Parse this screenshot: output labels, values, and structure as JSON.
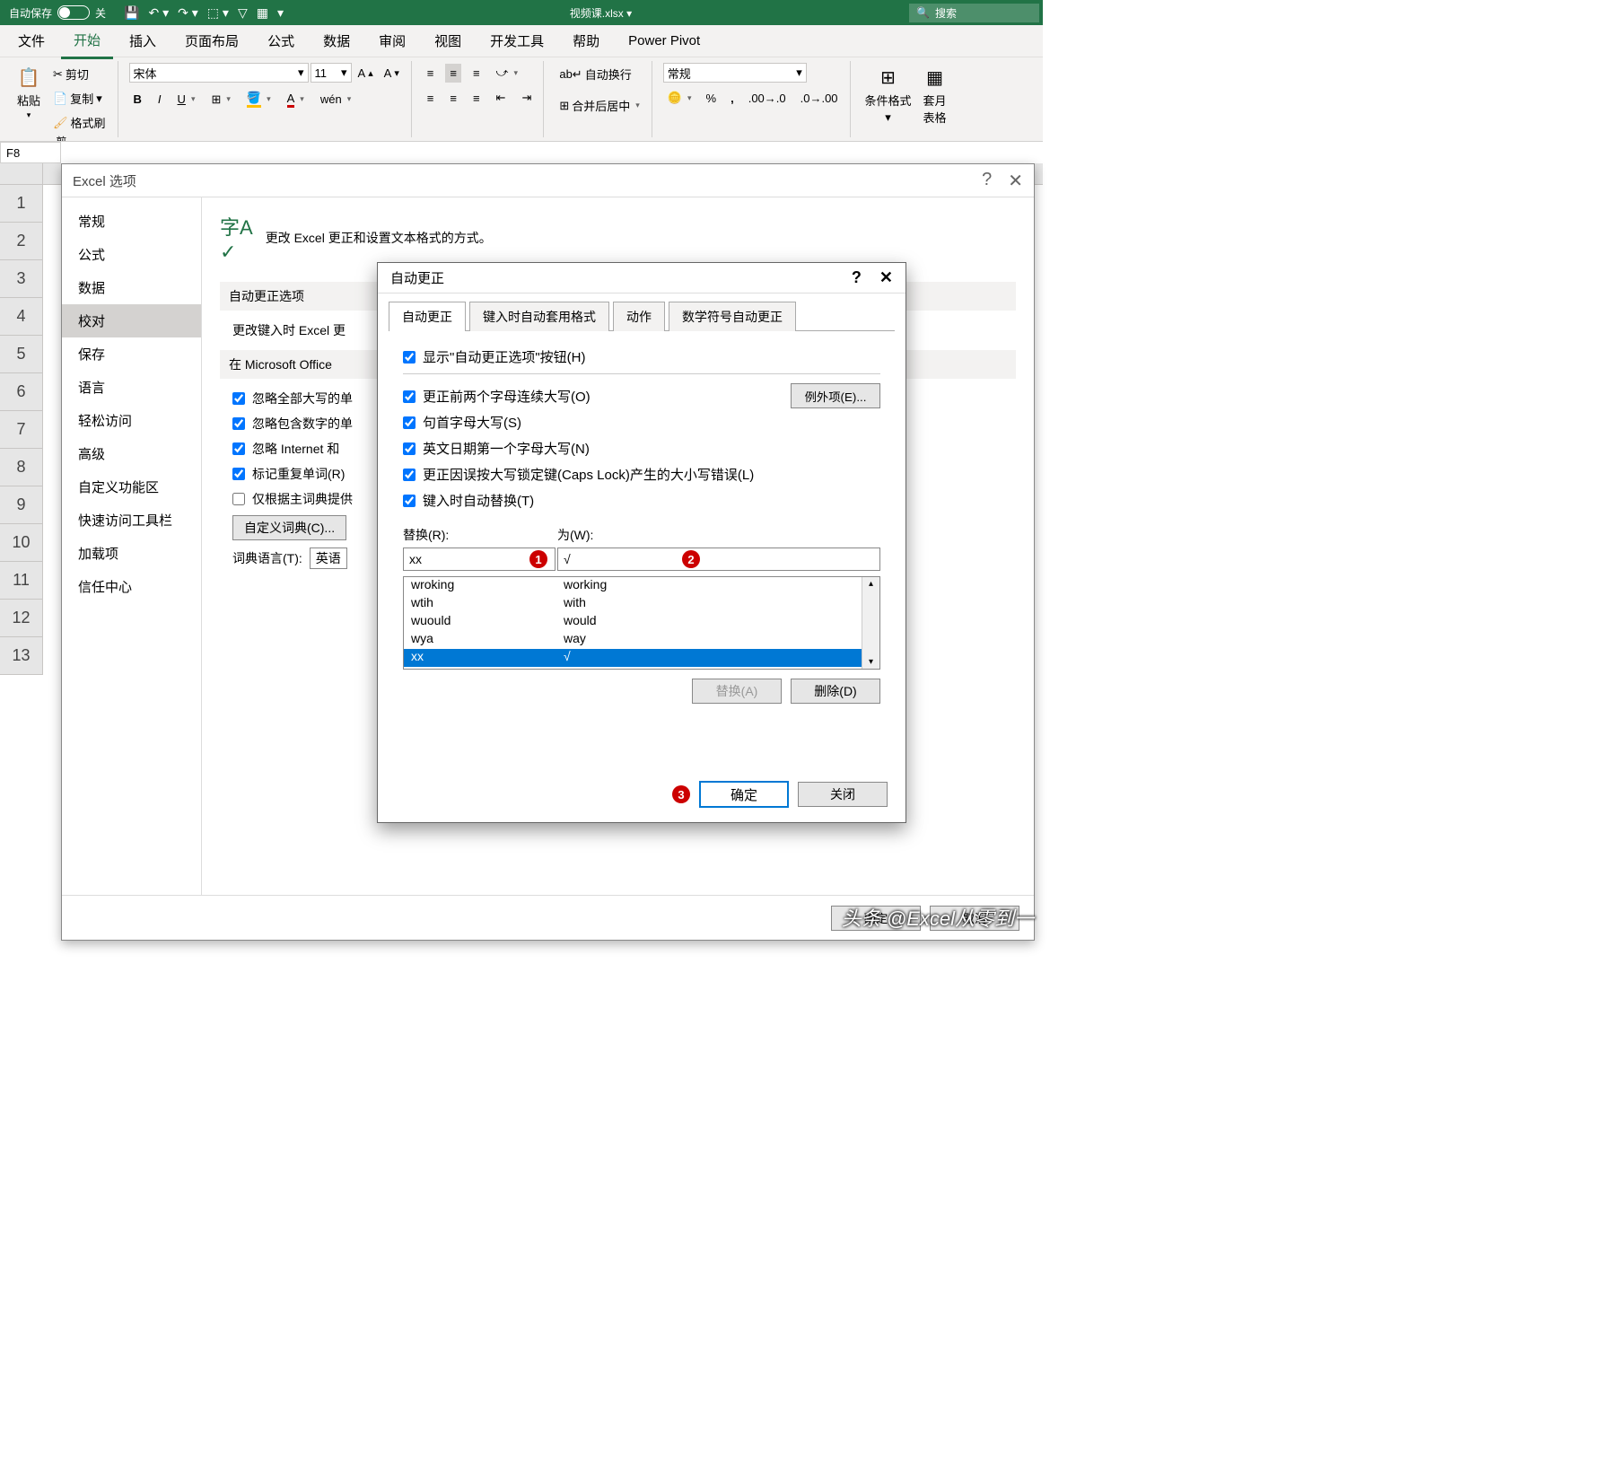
{
  "titlebar": {
    "autosave": "自动保存",
    "autosave_state": "关",
    "doc_title": "视频课.xlsx",
    "search_placeholder": "搜索"
  },
  "ribbon_tabs": [
    "文件",
    "开始",
    "插入",
    "页面布局",
    "公式",
    "数据",
    "审阅",
    "视图",
    "开发工具",
    "帮助",
    "Power Pivot"
  ],
  "ribbon_active_tab": 1,
  "ribbon": {
    "clipboard": {
      "paste": "粘贴",
      "cut": "剪切",
      "copy": "复制",
      "format_painter": "格式刷",
      "group": "剪"
    },
    "font": {
      "name": "宋体",
      "size": "11",
      "wen": "wén"
    },
    "alignment": {
      "wrap": "自动换行",
      "merge": "合并后居中"
    },
    "number": {
      "format": "常规"
    },
    "styles": {
      "conditional": "条件格式",
      "table": "套月\n表格"
    }
  },
  "name_box": "F8",
  "row_numbers": [
    1,
    2,
    3,
    4,
    5,
    6,
    7,
    8,
    9,
    10,
    11,
    12,
    13
  ],
  "options_dialog": {
    "title": "Excel 选项",
    "nav": [
      "常规",
      "公式",
      "数据",
      "校对",
      "保存",
      "语言",
      "轻松访问",
      "高级",
      "自定义功能区",
      "快速访问工具栏",
      "加载项",
      "信任中心"
    ],
    "nav_selected": 3,
    "header_text": "更改 Excel 更正和设置文本格式的方式。",
    "section1": "自动更正选项",
    "section1_label": "更改键入时 Excel 更",
    "section2": "在 Microsoft Office",
    "checks": [
      "忽略全部大写的单",
      "忽略包含数字的单",
      "忽略 Internet 和",
      "标记重复单词(R)",
      "仅根据主词典提供"
    ],
    "check_states": [
      true,
      true,
      true,
      true,
      false
    ],
    "custom_dict_btn": "自定义词典(C)...",
    "dict_lang_label": "词典语言(T):",
    "dict_lang_value": "英语",
    "ok": "确定",
    "cancel": "取消"
  },
  "autocorrect_dialog": {
    "title": "自动更正",
    "tabs": [
      "自动更正",
      "键入时自动套用格式",
      "动作",
      "数学符号自动更正"
    ],
    "active_tab": 0,
    "chk_show_btn": "显示\"自动更正选项\"按钮(H)",
    "chk_two_caps": "更正前两个字母连续大写(O)",
    "chk_sentence": "句首字母大写(S)",
    "chk_days": "英文日期第一个字母大写(N)",
    "chk_capslock": "更正因误按大写锁定键(Caps Lock)产生的大小写错误(L)",
    "chk_replace": "键入时自动替换(T)",
    "exceptions_btn": "例外项(E)...",
    "replace_label": "替换(R):",
    "with_label": "为(W):",
    "replace_value": "xx",
    "with_value": "√",
    "list": [
      {
        "from": "wroking",
        "to": "working"
      },
      {
        "from": "wtih",
        "to": "with"
      },
      {
        "from": "wuould",
        "to": "would"
      },
      {
        "from": "wya",
        "to": "way"
      },
      {
        "from": "xx",
        "to": "√"
      }
    ],
    "selected_row": 4,
    "replace_btn": "替换(A)",
    "delete_btn": "删除(D)",
    "ok": "确定",
    "close": "关闭"
  },
  "watermark": "头条 @Excel从零到一"
}
